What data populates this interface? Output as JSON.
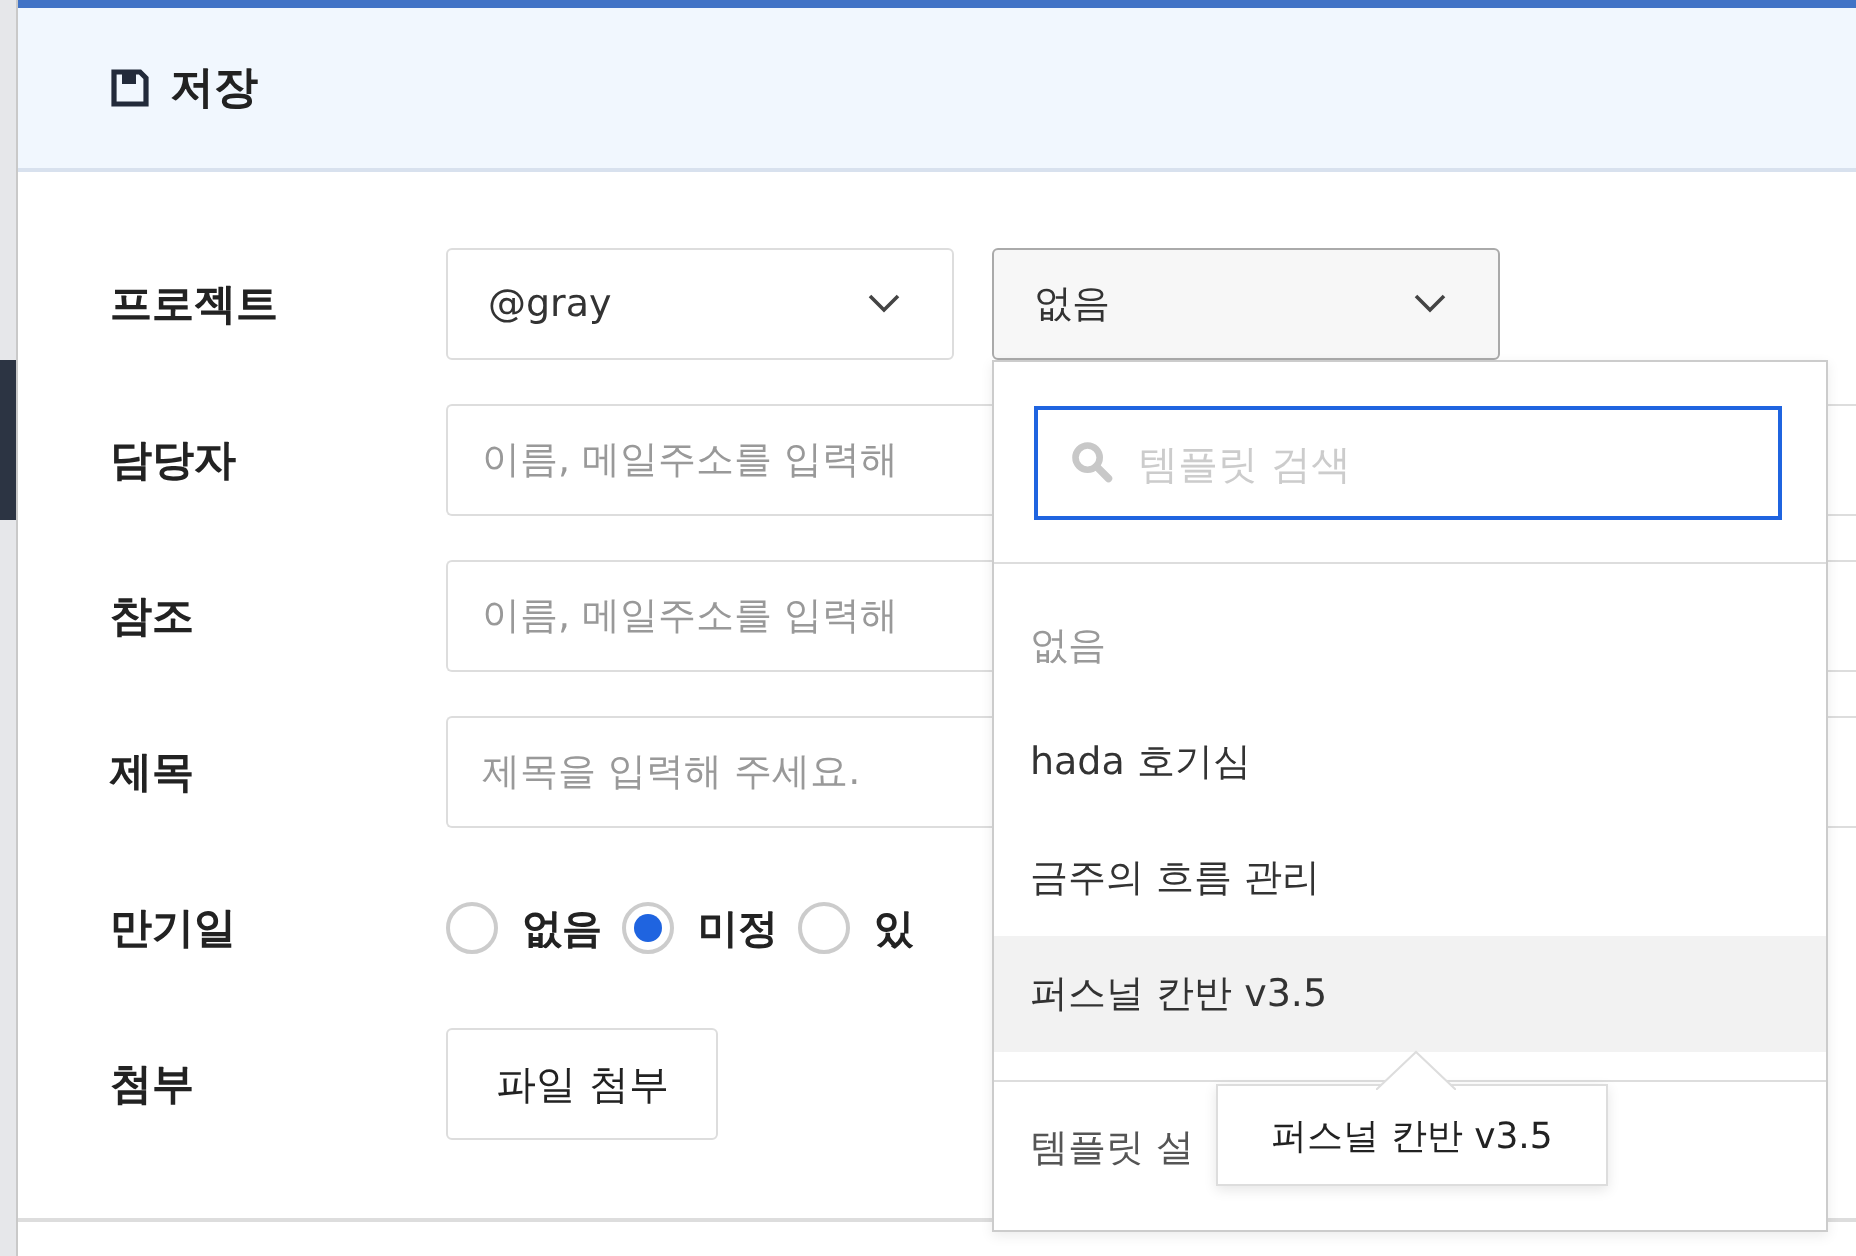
{
  "dialog": {
    "title": "저장"
  },
  "form": [
    {
      "kind": "selects",
      "label": "프로젝트",
      "selects": [
        {
          "value": "@gray",
          "open": false
        },
        {
          "value": "없음",
          "open": true
        }
      ]
    },
    {
      "kind": "text",
      "label": "담당자",
      "placeholder": "이름, 메일주소를 입력해"
    },
    {
      "kind": "text",
      "label": "참조",
      "placeholder": "이름, 메일주소를 입력해"
    },
    {
      "kind": "text",
      "label": "제목",
      "placeholder": "제목을 입력해 주세요."
    },
    {
      "kind": "radio",
      "label": "만기일",
      "options": [
        {
          "label": "없음",
          "selected": false
        },
        {
          "label": "미정",
          "selected": true
        },
        {
          "label": "있",
          "selected": false
        }
      ]
    },
    {
      "kind": "button",
      "label": "첨부",
      "button": "파일 첨부"
    }
  ],
  "template_menu": {
    "search_placeholder": "템플릿 검색",
    "items": [
      {
        "label": "없음",
        "disabled": true,
        "hovered": false
      },
      {
        "label": "hada 호기심",
        "disabled": false,
        "hovered": false
      },
      {
        "label": "금주의 흐름 관리",
        "disabled": false,
        "hovered": false
      },
      {
        "label": "퍼스널 칸반 v3.5",
        "disabled": false,
        "hovered": true
      }
    ],
    "footer": "템플릿 설",
    "tooltip": "퍼스널 칸반 v3.5"
  }
}
